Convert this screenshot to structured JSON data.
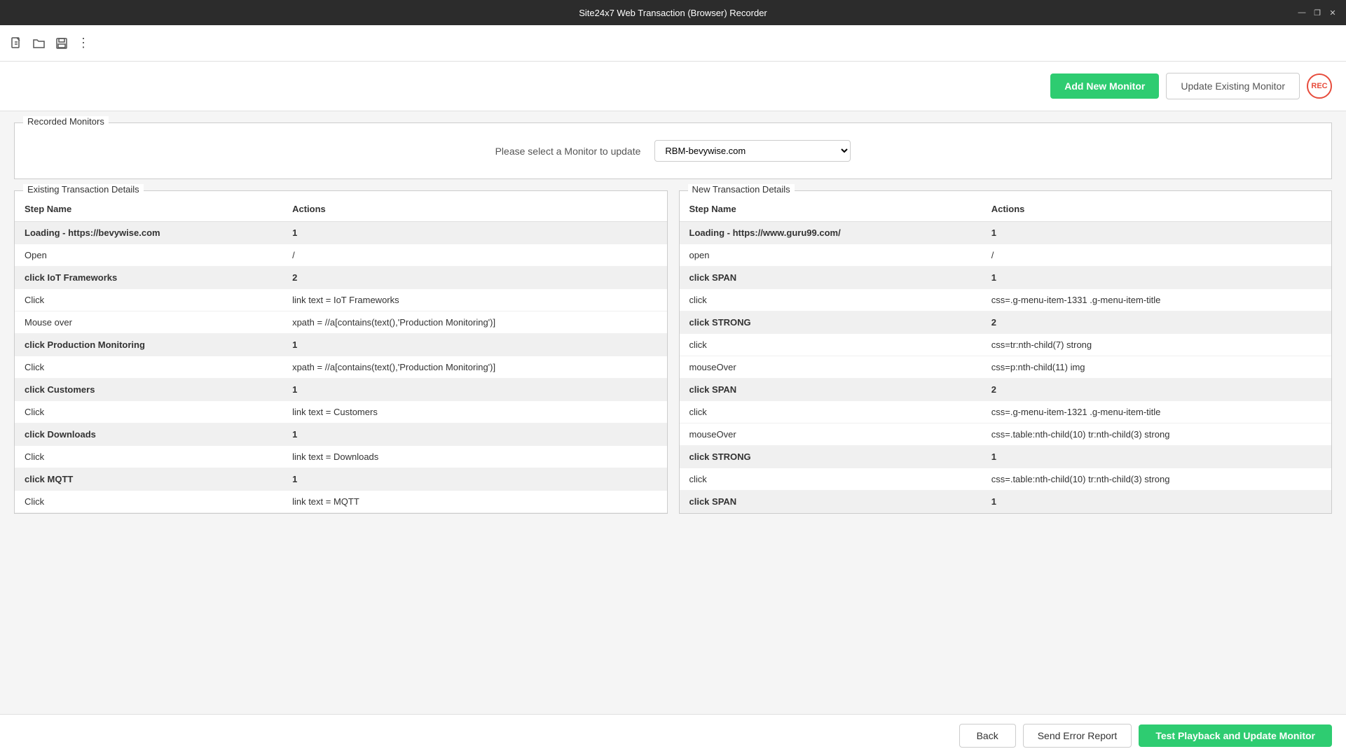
{
  "titleBar": {
    "title": "Site24x7 Web Transaction (Browser) Recorder",
    "controls": {
      "minimize": "—",
      "restore": "❐",
      "close": "✕"
    }
  },
  "toolbar": {
    "icons": [
      "new-file",
      "open-folder",
      "save",
      "more-options"
    ]
  },
  "header": {
    "addMonitorLabel": "Add New Monitor",
    "updateMonitorLabel": "Update Existing Monitor",
    "recLabel": "REC"
  },
  "recordedMonitors": {
    "sectionLabel": "Recorded Monitors",
    "selectLabel": "Please select a Monitor to update",
    "selectValue": "RBM-bevywise.com",
    "selectOptions": [
      "RBM-bevywise.com"
    ]
  },
  "existingPanel": {
    "label": "Existing Transaction Details",
    "stepNameHeader": "Step Name",
    "actionsHeader": "Actions",
    "rows": [
      {
        "type": "step",
        "stepName": "Loading - https://bevywise.com",
        "actions": "1"
      },
      {
        "type": "action",
        "stepName": "Open",
        "actions": "/"
      },
      {
        "type": "step",
        "stepName": "click IoT Frameworks",
        "actions": "2"
      },
      {
        "type": "action",
        "stepName": "Click",
        "actions": "link text = IoT Frameworks"
      },
      {
        "type": "action",
        "stepName": "Mouse over",
        "actions": "xpath = //a[contains(text(),'Production Monitoring')]"
      },
      {
        "type": "step",
        "stepName": "click Production Monitoring",
        "actions": "1"
      },
      {
        "type": "action",
        "stepName": "Click",
        "actions": "xpath = //a[contains(text(),'Production Monitoring')]"
      },
      {
        "type": "step",
        "stepName": "click Customers",
        "actions": "1"
      },
      {
        "type": "action",
        "stepName": "Click",
        "actions": "link text = Customers"
      },
      {
        "type": "step",
        "stepName": "click Downloads",
        "actions": "1"
      },
      {
        "type": "action",
        "stepName": "Click",
        "actions": "link text = Downloads"
      },
      {
        "type": "step",
        "stepName": "click MQTT",
        "actions": "1"
      },
      {
        "type": "action",
        "stepName": "Click",
        "actions": "link text = MQTT"
      }
    ]
  },
  "newPanel": {
    "label": "New Transaction Details",
    "stepNameHeader": "Step Name",
    "actionsHeader": "Actions",
    "rows": [
      {
        "type": "step",
        "stepName": "Loading - https://www.guru99.com/",
        "actions": "1"
      },
      {
        "type": "action",
        "stepName": "open",
        "actions": "/"
      },
      {
        "type": "step",
        "stepName": "click SPAN",
        "actions": "1"
      },
      {
        "type": "action",
        "stepName": "click",
        "actions": "css=.g-menu-item-1331 .g-menu-item-title"
      },
      {
        "type": "step",
        "stepName": "click STRONG",
        "actions": "2"
      },
      {
        "type": "action",
        "stepName": "click",
        "actions": "css=tr:nth-child(7) strong"
      },
      {
        "type": "action",
        "stepName": "mouseOver",
        "actions": "css=p:nth-child(11) img"
      },
      {
        "type": "step",
        "stepName": "click SPAN",
        "actions": "2"
      },
      {
        "type": "action",
        "stepName": "click",
        "actions": "css=.g-menu-item-1321 .g-menu-item-title"
      },
      {
        "type": "action",
        "stepName": "mouseOver",
        "actions": "css=.table:nth-child(10) tr:nth-child(3) strong"
      },
      {
        "type": "step",
        "stepName": "click STRONG",
        "actions": "1"
      },
      {
        "type": "action",
        "stepName": "click",
        "actions": "css=.table:nth-child(10) tr:nth-child(3) strong"
      },
      {
        "type": "step",
        "stepName": "click SPAN",
        "actions": "1"
      }
    ]
  },
  "footer": {
    "backLabel": "Back",
    "sendErrorLabel": "Send Error Report",
    "testPlaybackLabel": "Test Playback and Update Monitor"
  }
}
